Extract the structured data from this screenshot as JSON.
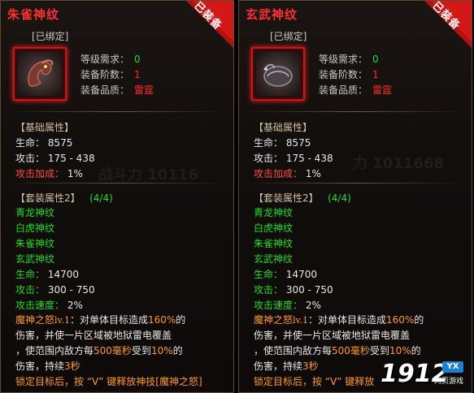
{
  "panels": [
    {
      "title": "朱雀神纹",
      "bound": "[已绑定]",
      "equipped": "已装备",
      "icon": "vermilion-bird-rune-icon",
      "req": {
        "level_label": "等级需求：",
        "level_value": "0",
        "tier_label": "装备阶数：",
        "tier_value": "1",
        "quality_label": "装备品质：",
        "quality_value": "雷霆"
      },
      "base_header": "【基础属性】",
      "hp": "生命： 8575",
      "atk": "攻击： 175 - 438",
      "atkbonus_label": "攻击加成：",
      "atkbonus_value": " 1%",
      "set_header": "【套装属性2】",
      "set_count": "(4/4)",
      "set_items": [
        "青龙神纹",
        "白虎神纹",
        "朱雀神纹",
        "玄武神纹"
      ],
      "set_hp_label": "生命：",
      "set_hp_value": " 14700",
      "set_atk_label": "攻击：",
      "set_atk_value": " 300 - 750",
      "set_speed_label": "攻击速度：",
      "set_speed_value": " 2%",
      "skill_name": "魔神之怒",
      "skill_lv": "lv.1",
      "skill_t1": "：对单体目标造成",
      "skill_pct": "160%",
      "skill_t2": "的",
      "skill_line2": "伤害，并使一片区域被地狱雷电覆盖",
      "skill_line3a": "，使范围内敌方每",
      "skill_ms": "500毫秒",
      "skill_line3b": "受到",
      "skill_pct2": "10%",
      "skill_line3c": "的",
      "skill_line4a": "伤害，持续",
      "skill_sec": "3秒",
      "hint": "锁定目标后，按 “V” 键释放神技[魔神之怒]",
      "ghost": "战斗力 10116"
    },
    {
      "title": "玄武神纹",
      "bound": "[已绑定]",
      "equipped": "已装备",
      "icon": "black-tortoise-rune-icon",
      "req": {
        "level_label": "等级需求：",
        "level_value": "0",
        "tier_label": "装备阶数：",
        "tier_value": "1",
        "quality_label": "装备品质：",
        "quality_value": "雷霆"
      },
      "base_header": "【基础属性】",
      "hp": "生命： 8575",
      "atk": "攻击： 175 - 438",
      "atkbonus_label": "攻击加成：",
      "atkbonus_value": " 1%",
      "set_header": "【套装属性2】",
      "set_count": "(4/4)",
      "set_items": [
        "青龙神纹",
        "白虎神纹",
        "朱雀神纹",
        "玄武神纹"
      ],
      "set_hp_label": "生命：",
      "set_hp_value": " 14700",
      "set_atk_label": "攻击：",
      "set_atk_value": " 300 - 750",
      "set_speed_label": "攻击速度：",
      "set_speed_value": " 2%",
      "skill_name": "魔神之怒",
      "skill_lv": "lv.1",
      "skill_t1": "：对单体目标造成",
      "skill_pct": "160%",
      "skill_t2": "的",
      "skill_line2": "伤害，并使一片区域被地狱雷电覆盖",
      "skill_line3a": "，使范围内敌方每",
      "skill_ms": "500毫秒",
      "skill_line3b": "受到",
      "skill_pct2": "10%",
      "skill_line3c": "的",
      "skill_line4a": "伤害，持续",
      "skill_sec": "3秒",
      "hint": "锁定目标后，按 “V” 键释放",
      "ghost": "力 1011668"
    }
  ],
  "watermark": {
    "number": "1912",
    "badge": "YX",
    "sub": "网页游戏"
  }
}
